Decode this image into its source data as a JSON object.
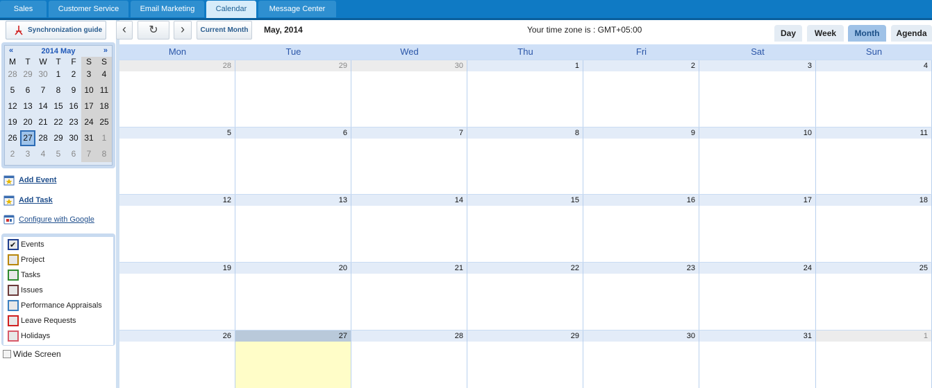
{
  "top_tabs": [
    {
      "label": "Sales"
    },
    {
      "label": "Customer Service"
    },
    {
      "label": "Email Marketing"
    },
    {
      "label": "Calendar",
      "active": true
    },
    {
      "label": "Message Center"
    }
  ],
  "sidebar": {
    "sync_guide_label": "Synchronization guide",
    "mini_calendar": {
      "prev": "«",
      "next": "»",
      "title": "2014 May",
      "dow": [
        "M",
        "T",
        "W",
        "T",
        "F",
        "S",
        "S"
      ],
      "weeks": [
        [
          "28",
          "29",
          "30",
          "1",
          "2",
          "3",
          "4"
        ],
        [
          "5",
          "6",
          "7",
          "8",
          "9",
          "10",
          "11"
        ],
        [
          "12",
          "13",
          "14",
          "15",
          "16",
          "17",
          "18"
        ],
        [
          "19",
          "20",
          "21",
          "22",
          "23",
          "24",
          "25"
        ],
        [
          "26",
          "27",
          "28",
          "29",
          "30",
          "31",
          "1"
        ],
        [
          "2",
          "3",
          "4",
          "5",
          "6",
          "7",
          "8"
        ]
      ],
      "today": "27"
    },
    "add_event": "Add Event",
    "add_task": "Add Task",
    "configure_google": "Configure with Google",
    "filters": [
      {
        "label": "Events",
        "color": "#1f3f8f",
        "checked": true
      },
      {
        "label": "Project",
        "color": "#b8860b",
        "checked": false
      },
      {
        "label": "Tasks",
        "color": "#2e8b2e",
        "checked": false
      },
      {
        "label": "Issues",
        "color": "#6b3a3a",
        "checked": false
      },
      {
        "label": "Performance Appraisals",
        "color": "#3a7fc1",
        "checked": false
      },
      {
        "label": "Leave Requests",
        "color": "#d02020",
        "checked": false
      },
      {
        "label": "Holidays",
        "color": "#d85a6a",
        "checked": false
      }
    ],
    "wide_screen": "Wide Screen"
  },
  "toolbar": {
    "prev": "‹",
    "refresh": "↻",
    "next": "›",
    "current_month": "Current Month",
    "month_label": "May, 2014",
    "timezone": "Your time zone is : GMT+05:00",
    "views": [
      "Day",
      "Week",
      "Month",
      "Agenda"
    ],
    "active_view": "Month"
  },
  "calendar": {
    "dow": [
      "Mon",
      "Tue",
      "Wed",
      "Thu",
      "Fri",
      "Sat",
      "Sun"
    ],
    "weeks": [
      [
        "28",
        "29",
        "30",
        "1",
        "2",
        "3",
        "4"
      ],
      [
        "5",
        "6",
        "7",
        "8",
        "9",
        "10",
        "11"
      ],
      [
        "12",
        "13",
        "14",
        "15",
        "16",
        "17",
        "18"
      ],
      [
        "19",
        "20",
        "21",
        "22",
        "23",
        "24",
        "25"
      ],
      [
        "26",
        "27",
        "28",
        "29",
        "30",
        "31",
        "1"
      ]
    ],
    "today": "27"
  }
}
